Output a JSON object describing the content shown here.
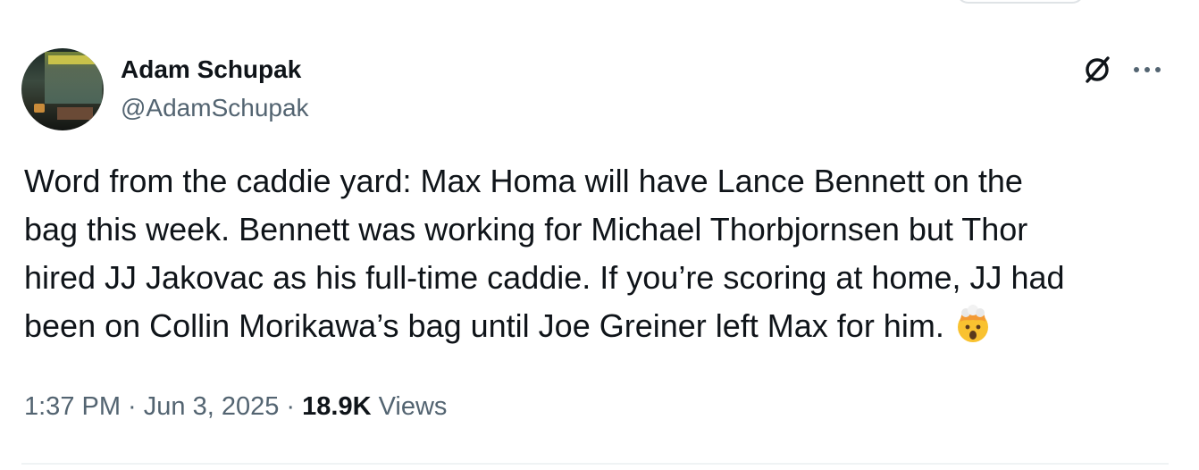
{
  "author": {
    "name": "Adam Schupak",
    "handle": "@AdamSchupak"
  },
  "tweet": {
    "text": "Word from the caddie yard: Max Homa will have Lance Bennett on the\nbag this week. Bennett was working for Michael Thorbjornsen but Thor\nhired JJ Jakovac as his full-time caddie. If you’re scoring at home, JJ had\nbeen on Collin Morikawa’s bag until Joe Greiner left Max for him.",
    "emoji": "exploding-head-emoji"
  },
  "meta": {
    "time": "1:37 PM",
    "separator1": " · ",
    "date": "Jun 3, 2025",
    "separator2": " · ",
    "views_count": "18.9K",
    "views_label": " Views"
  },
  "icons": {
    "grok": "grok-icon",
    "more": "more-dots-icon"
  },
  "colors": {
    "text_primary": "#0f1419",
    "text_secondary": "#536471",
    "divider": "#eff3f4"
  }
}
